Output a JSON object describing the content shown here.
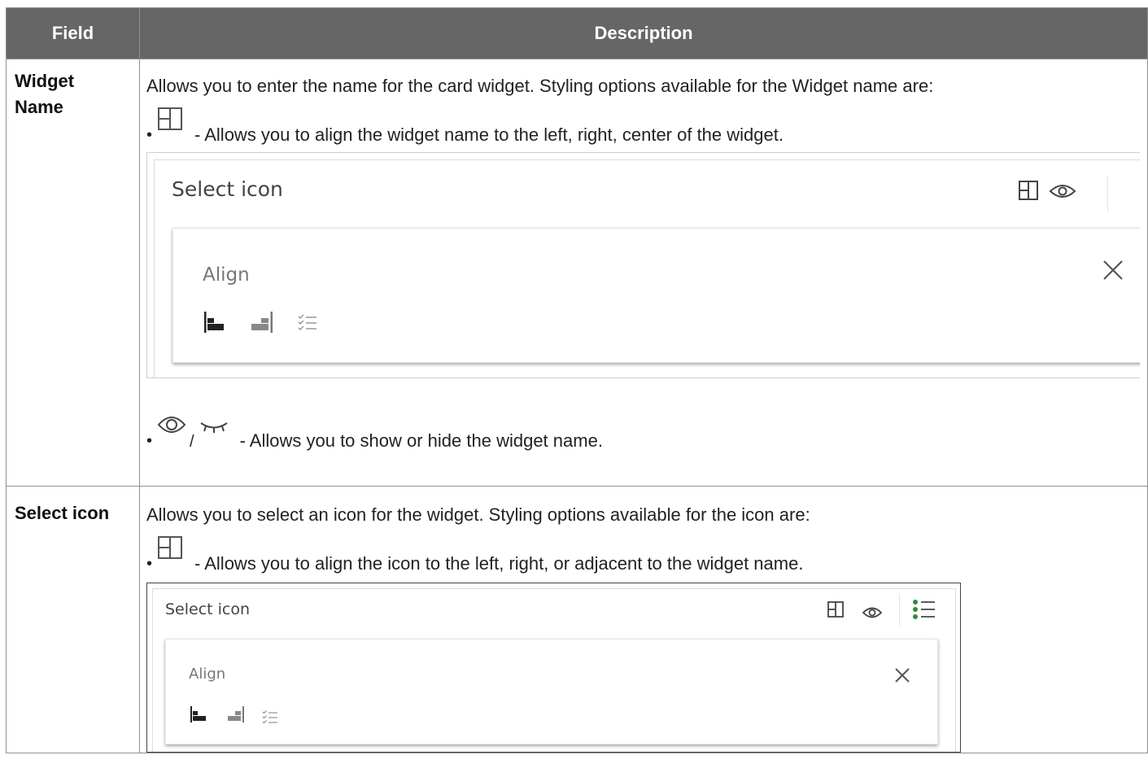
{
  "table": {
    "headers": {
      "field": "Field",
      "description": "Description"
    },
    "rows": [
      {
        "field_line1": "Widget",
        "field_line2": "Name",
        "intro": "Allows you to enter the name for the card widget. Styling options available for the Widget name are:",
        "bullet_align": "- Allows you to align the widget name to the left, right, center of the widget.",
        "bullet_visibility_sep": "/",
        "bullet_visibility": "- Allows you to show or hide the widget name.",
        "screenshot": {
          "title": "Select icon",
          "panel_label": "Align"
        }
      },
      {
        "field": "Select icon",
        "intro": "Allows you to select an icon for the widget. Styling options available for the icon are:",
        "bullet_align": "- Allows you to align the icon to the left, right, or adjacent to the widget name.",
        "screenshot": {
          "title": "Select icon",
          "panel_label": "Align"
        }
      }
    ]
  },
  "icons": {
    "layout": "layout-split-icon",
    "eye": "eye-icon",
    "eye_closed": "eye-closed-icon",
    "close": "close-icon",
    "align_left": "align-left-icon",
    "align_right": "align-right-icon",
    "align_adjacent": "align-adjacent-icon",
    "list": "list-icon"
  },
  "colors": {
    "header_bg": "#666666",
    "accent_green": "#2e8b3a"
  }
}
